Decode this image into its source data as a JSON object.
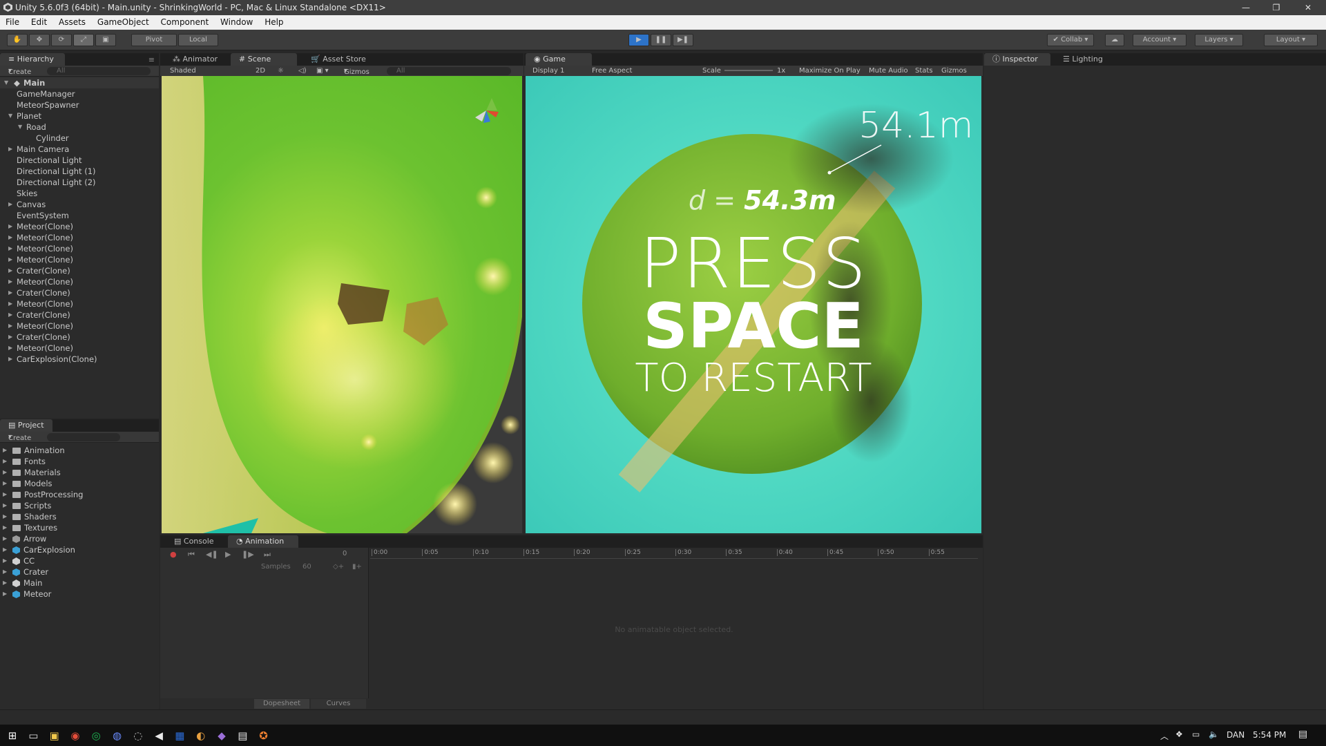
{
  "window": {
    "title": "Unity 5.6.0f3 (64bit) - Main.unity - ShrinkingWorld - PC, Mac & Linux Standalone <DX11>",
    "controls": [
      "—",
      "❐",
      "✕"
    ]
  },
  "menu": [
    "File",
    "Edit",
    "Assets",
    "GameObject",
    "Component",
    "Window",
    "Help"
  ],
  "toolbar": {
    "pivot": "Pivot",
    "local": "Local",
    "collab": "Collab",
    "account": "Account",
    "layers": "Layers",
    "layout": "Layout"
  },
  "hierarchy": {
    "tab": "Hierarchy",
    "create": "Create",
    "search_placeholder": "All",
    "scene_name": "Main",
    "items": [
      {
        "label": "GameManager",
        "indent": 1,
        "expander": ""
      },
      {
        "label": "MeteorSpawner",
        "indent": 1,
        "expander": ""
      },
      {
        "label": "Planet",
        "indent": 1,
        "expander": "▼"
      },
      {
        "label": "Road",
        "indent": 2,
        "expander": "▼"
      },
      {
        "label": "Cylinder",
        "indent": 3,
        "expander": ""
      },
      {
        "label": "Main Camera",
        "indent": 1,
        "expander": "▶"
      },
      {
        "label": "Directional Light",
        "indent": 1,
        "expander": ""
      },
      {
        "label": "Directional Light (1)",
        "indent": 1,
        "expander": ""
      },
      {
        "label": "Directional Light (2)",
        "indent": 1,
        "expander": ""
      },
      {
        "label": "Skies",
        "indent": 1,
        "expander": ""
      },
      {
        "label": "Canvas",
        "indent": 1,
        "expander": "▶"
      },
      {
        "label": "EventSystem",
        "indent": 1,
        "expander": ""
      },
      {
        "label": "Meteor(Clone)",
        "indent": 1,
        "expander": "▶"
      },
      {
        "label": "Meteor(Clone)",
        "indent": 1,
        "expander": "▶"
      },
      {
        "label": "Meteor(Clone)",
        "indent": 1,
        "expander": "▶"
      },
      {
        "label": "Meteor(Clone)",
        "indent": 1,
        "expander": "▶"
      },
      {
        "label": "Crater(Clone)",
        "indent": 1,
        "expander": "▶"
      },
      {
        "label": "Meteor(Clone)",
        "indent": 1,
        "expander": "▶"
      },
      {
        "label": "Crater(Clone)",
        "indent": 1,
        "expander": "▶"
      },
      {
        "label": "Meteor(Clone)",
        "indent": 1,
        "expander": "▶"
      },
      {
        "label": "Crater(Clone)",
        "indent": 1,
        "expander": "▶"
      },
      {
        "label": "Meteor(Clone)",
        "indent": 1,
        "expander": "▶"
      },
      {
        "label": "Crater(Clone)",
        "indent": 1,
        "expander": "▶"
      },
      {
        "label": "Meteor(Clone)",
        "indent": 1,
        "expander": "▶"
      },
      {
        "label": "CarExplosion(Clone)",
        "indent": 1,
        "expander": "▶"
      }
    ]
  },
  "scene_tabs": {
    "animator": "Animator",
    "scene": "Scene",
    "asset_store": "Asset Store",
    "shading": "Shaded",
    "mode_2d": "2D",
    "gizmos": "Gizmos",
    "search_placeholder": "All"
  },
  "game": {
    "tab": "Game",
    "display": "Display 1",
    "aspect": "Free Aspect",
    "scale_label": "Scale",
    "scale_value": "1x",
    "maximize": "Maximize On Play",
    "mute": "Mute Audio",
    "stats": "Stats",
    "gizmos": "Gizmos",
    "hud_distance_top": "54.1m",
    "hud_d_prefix": "d = ",
    "hud_d_value": "54.3m",
    "press": "PRESS",
    "space": "SPACE",
    "restart": "TO RESTART"
  },
  "inspector": {
    "tab": "Inspector",
    "lighting_tab": "Lighting"
  },
  "project": {
    "tab": "Project",
    "create": "Create",
    "items": [
      {
        "label": "Animation",
        "icon": "folder"
      },
      {
        "label": "Fonts",
        "icon": "folder"
      },
      {
        "label": "Materials",
        "icon": "folder"
      },
      {
        "label": "Models",
        "icon": "folder"
      },
      {
        "label": "PostProcessing",
        "icon": "folder"
      },
      {
        "label": "Scripts",
        "icon": "folder"
      },
      {
        "label": "Shaders",
        "icon": "folder"
      },
      {
        "label": "Textures",
        "icon": "folder"
      },
      {
        "label": "Arrow",
        "icon": "model"
      },
      {
        "label": "CarExplosion",
        "icon": "prefab"
      },
      {
        "label": "CC",
        "icon": "unity"
      },
      {
        "label": "Crater",
        "icon": "prefab"
      },
      {
        "label": "Main",
        "icon": "unity"
      },
      {
        "label": "Meteor",
        "icon": "prefab"
      }
    ]
  },
  "bottom_tabs": {
    "console": "Console",
    "animation": "Animation",
    "frame": "0",
    "samples_label": "Samples",
    "samples_value": "60",
    "timeline_ticks": [
      "0:00",
      "0:05",
      "0:10",
      "0:15",
      "0:20",
      "0:25",
      "0:30",
      "0:35",
      "0:40",
      "0:45",
      "0:50",
      "0:55"
    ],
    "empty_message": "No animatable object selected.",
    "dopesheet": "Dopesheet",
    "curves": "Curves"
  },
  "taskbar": {
    "language": "DAN",
    "time": "5:54 PM",
    "apps": [
      "windows-icon",
      "task-view-icon",
      "file-explorer-icon",
      "chrome-icon",
      "spotify-icon",
      "browser-icon",
      "unity-hub-icon",
      "unity-icon",
      "photoshop-icon",
      "blender-icon",
      "visual-studio-icon",
      "calculator-icon",
      "game-icon"
    ]
  },
  "colors": {
    "editor_bg": "#282828",
    "play_active": "#2d73c8",
    "game_sky": "#4fd8c2",
    "planet": "#7bb536"
  }
}
